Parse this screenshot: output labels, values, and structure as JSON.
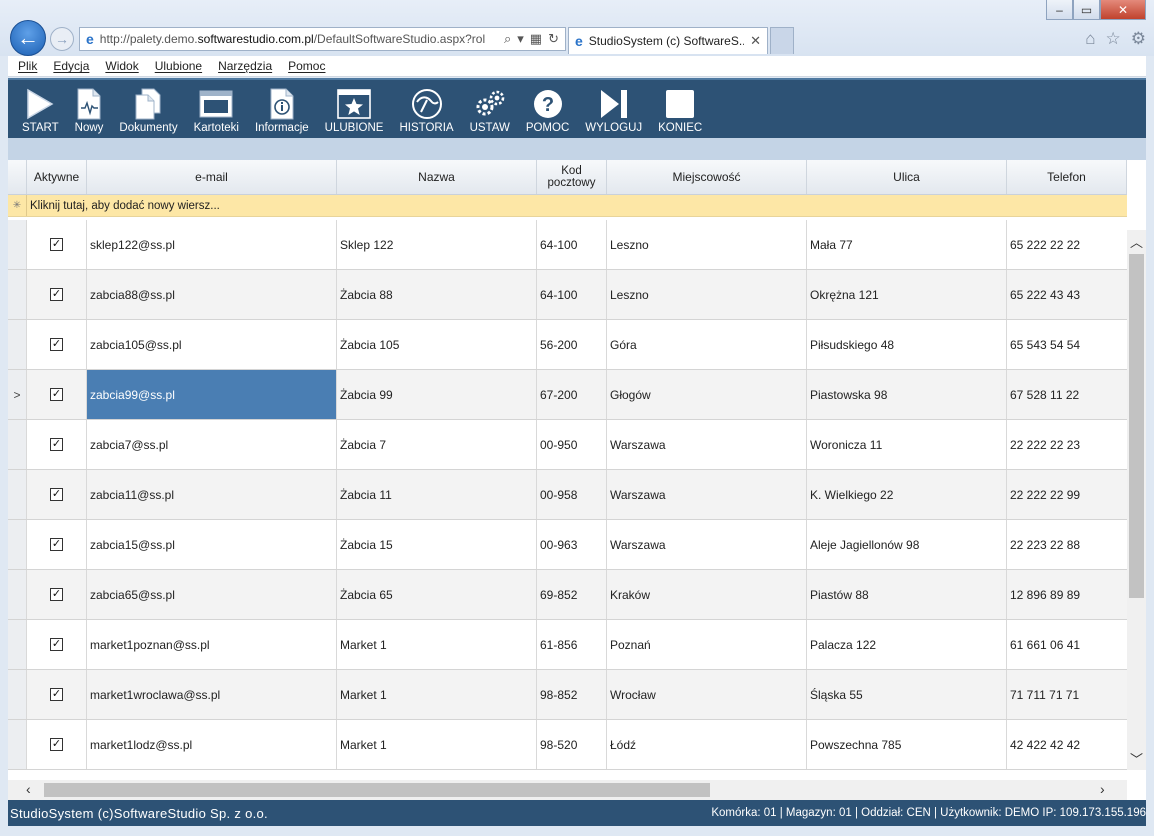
{
  "browser": {
    "url_prefix": "http://palety.demo.",
    "url_domain": "softwarestudio.com.pl",
    "url_suffix": "/DefaultSoftwareStudio.aspx?rol",
    "tab_title": "StudioSystem (c) SoftwareS...",
    "tab_close": "✕",
    "win_min": "–",
    "win_max": "▭",
    "win_close": "✕"
  },
  "menu": [
    "Plik",
    "Edycja",
    "Widok",
    "Ulubione",
    "Narzędzia",
    "Pomoc"
  ],
  "toolbar": [
    {
      "label": "START",
      "icon": "play-icon"
    },
    {
      "label": "Nowy",
      "icon": "new-document-icon"
    },
    {
      "label": "Dokumenty",
      "icon": "documents-icon"
    },
    {
      "label": "Kartoteki",
      "icon": "window-icon"
    },
    {
      "label": "Informacje",
      "icon": "info-document-icon"
    },
    {
      "label": "ULUBIONE",
      "icon": "star-icon"
    },
    {
      "label": "HISTORIA",
      "icon": "history-icon"
    },
    {
      "label": "USTAW",
      "icon": "gears-icon"
    },
    {
      "label": "POMOC",
      "icon": "help-icon"
    },
    {
      "label": "WYLOGUJ",
      "icon": "logout-icon"
    },
    {
      "label": "KONIEC",
      "icon": "stop-icon"
    }
  ],
  "grid": {
    "columns": [
      "Aktywne",
      "e-mail",
      "Nazwa",
      "Kod pocztowy",
      "Miejscowość",
      "Ulica",
      "Telefon"
    ],
    "kod_line1": "Kod",
    "kod_line2": "pocztowy",
    "new_row_text": "Kliknij tutaj, aby dodać nowy wiersz...",
    "new_row_marker": "✳",
    "current_row_marker": ">",
    "selected_row_index": 3,
    "rows": [
      {
        "aktywne": true,
        "email": "sklep122@ss.pl",
        "nazwa": "Sklep 122",
        "kod": "64-100",
        "miejscowosc": "Leszno",
        "ulica": "Mała 77",
        "telefon": "65 222 22 22"
      },
      {
        "aktywne": true,
        "email": "zabcia88@ss.pl",
        "nazwa": "Żabcia 88",
        "kod": "64-100",
        "miejscowosc": "Leszno",
        "ulica": "Okrężna 121",
        "telefon": "65 222 43 43"
      },
      {
        "aktywne": true,
        "email": "zabcia105@ss.pl",
        "nazwa": "Żabcia 105",
        "kod": "56-200",
        "miejscowosc": "Góra",
        "ulica": "Piłsudskiego 48",
        "telefon": "65 543 54 54"
      },
      {
        "aktywne": true,
        "email": "zabcia99@ss.pl",
        "nazwa": "Żabcia 99",
        "kod": "67-200",
        "miejscowosc": "Głogów",
        "ulica": "Piastowska 98",
        "telefon": "67 528 11 22"
      },
      {
        "aktywne": true,
        "email": "zabcia7@ss.pl",
        "nazwa": "Żabcia 7",
        "kod": "00-950",
        "miejscowosc": "Warszawa",
        "ulica": "Woronicza 11",
        "telefon": "22 222 22 23"
      },
      {
        "aktywne": true,
        "email": "zabcia11@ss.pl",
        "nazwa": "Żabcia 11",
        "kod": "00-958",
        "miejscowosc": "Warszawa",
        "ulica": "K. Wielkiego 22",
        "telefon": "22 222 22 99"
      },
      {
        "aktywne": true,
        "email": "zabcia15@ss.pl",
        "nazwa": "Żabcia 15",
        "kod": "00-963",
        "miejscowosc": "Warszawa",
        "ulica": "Aleje Jagiellonów 98",
        "telefon": "22 223 22 88"
      },
      {
        "aktywne": true,
        "email": "zabcia65@ss.pl",
        "nazwa": "Żabcia 65",
        "kod": "69-852",
        "miejscowosc": "Kraków",
        "ulica": "Piastów 88",
        "telefon": "12 896 89 89"
      },
      {
        "aktywne": true,
        "email": "market1poznan@ss.pl",
        "nazwa": "Market 1",
        "kod": "61-856",
        "miejscowosc": "Poznań",
        "ulica": "Palacza 122",
        "telefon": "61 661 06 41"
      },
      {
        "aktywne": true,
        "email": "market1wroclawa@ss.pl",
        "nazwa": "Market 1",
        "kod": "98-852",
        "miejscowosc": "Wrocław",
        "ulica": "Śląska 55",
        "telefon": "71 711 71 71"
      },
      {
        "aktywne": true,
        "email": "market1lodz@ss.pl",
        "nazwa": "Market 1",
        "kod": "98-520",
        "miejscowosc": "Łódź",
        "ulica": "Powszechna 785",
        "telefon": "42 422 42 42"
      }
    ]
  },
  "status": {
    "left": "StudioSystem (c)SoftwareStudio Sp. z o.o.",
    "right": "Komórka: 01 | Magazyn: 01 | Oddział: CEN | Użytkownik: DEMO IP: 109.173.155.196"
  },
  "colors": {
    "toolbar_bg": "#2d5275",
    "selected_cell": "#4a7eb3",
    "new_row_bg": "#fde7a6"
  }
}
